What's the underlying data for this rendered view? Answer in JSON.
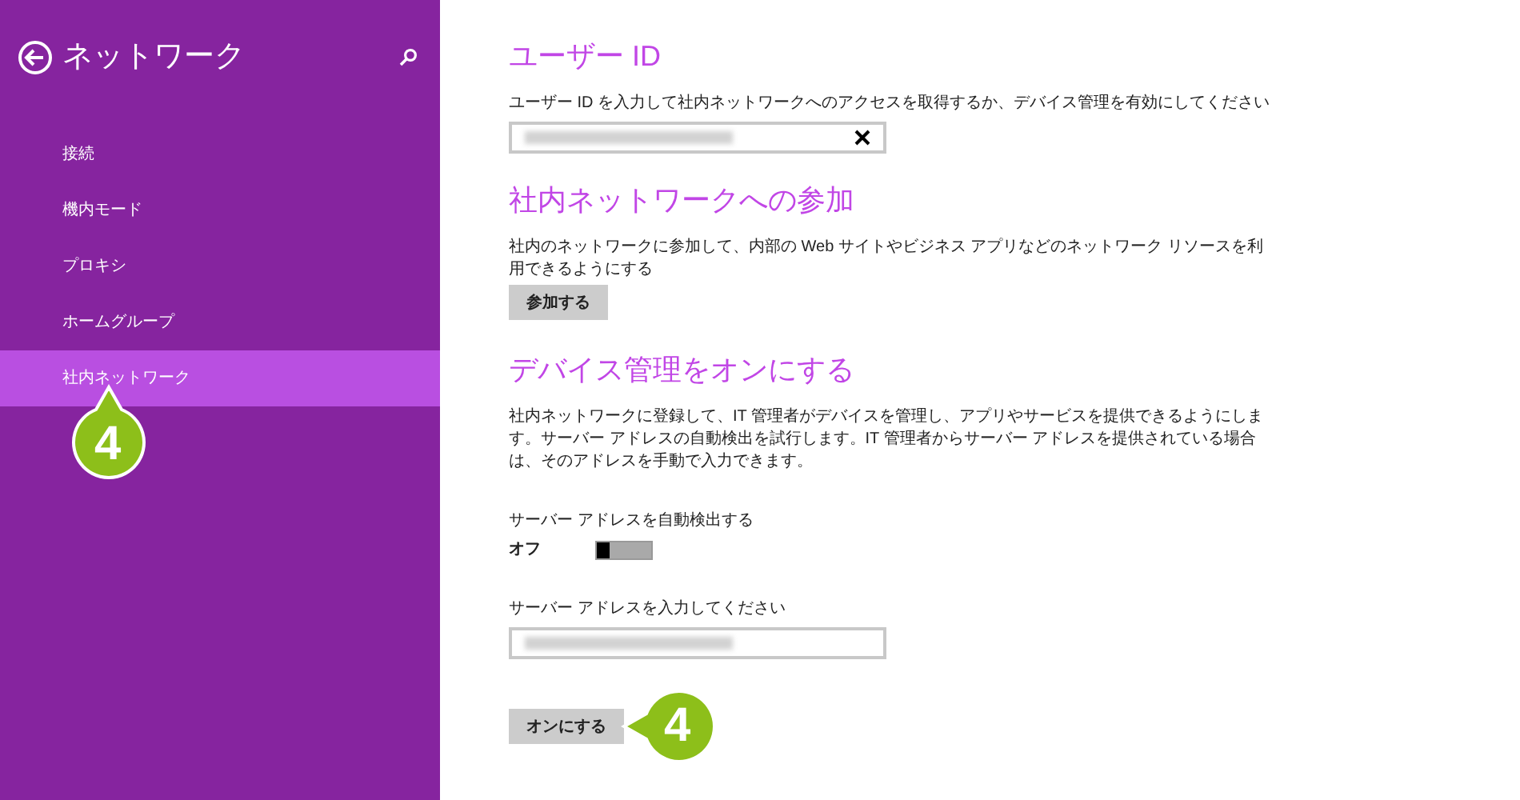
{
  "sidebar": {
    "title": "ネットワーク",
    "items": [
      {
        "label": "接続",
        "selected": false
      },
      {
        "label": "機内モード",
        "selected": false
      },
      {
        "label": "プロキシ",
        "selected": false
      },
      {
        "label": "ホームグループ",
        "selected": false
      },
      {
        "label": "社内ネットワーク",
        "selected": true
      }
    ],
    "callout": "4"
  },
  "user_id": {
    "heading": "ユーザー ID",
    "description": "ユーザー ID を入力して社内ネットワークへのアクセスを取得するか、デバイス管理を有効にしてください",
    "field": {
      "redacted": true
    }
  },
  "join": {
    "heading": "社内ネットワークへの参加",
    "description": "社内のネットワークに参加して、内部の Web サイトやビジネス アプリなどのネットワーク リソースを利用できるようにする",
    "button": "参加する"
  },
  "device_management": {
    "heading": "デバイス管理をオンにする",
    "description": "社内ネットワークに登録して、IT 管理者がデバイスを管理し、アプリやサービスを提供できるようにします。サーバー アドレスの自動検出を試行します。IT 管理者からサーバー アドレスを提供されている場合は、そのアドレスを手動で入力できます。",
    "auto_detect": {
      "label": "サーバー アドレスを自動検出する",
      "state_label": "オフ",
      "on": false
    },
    "server_address": {
      "label": "サーバー アドレスを入力してください",
      "redacted": true
    },
    "button": "オンにする",
    "callout": "4"
  }
}
